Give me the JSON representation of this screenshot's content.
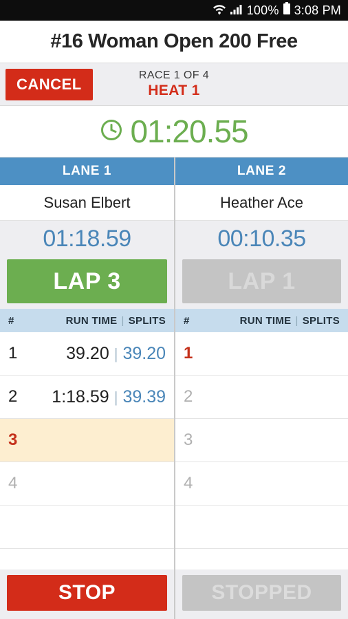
{
  "status_bar": {
    "wifi_icon": "wifi-icon",
    "signal_icon": "signal-bars-icon",
    "battery_percent": "100%",
    "battery_icon": "battery-full-icon",
    "time": "3:08 PM"
  },
  "header": {
    "title": "#16 Woman Open 200 Free"
  },
  "race_bar": {
    "cancel_label": "CANCEL",
    "race_line": "RACE 1 OF 4",
    "heat_line": "HEAT 1",
    "heat_color": "#d32c19"
  },
  "master_timer": {
    "clock_icon": "clock-icon",
    "value": "01:20.55",
    "color": "#6cae50"
  },
  "columns": {
    "num_header": "#",
    "run_time_header": "RUN TIME",
    "separator": "|",
    "splits_header": "SPLITS"
  },
  "lanes": [
    {
      "header": "LANE 1",
      "swimmer": "Susan Elbert",
      "elapsed": "01:18.59",
      "lap_label": "LAP 3",
      "lap_state": "active",
      "action_label": "STOP",
      "action_state": "active",
      "rows": [
        {
          "num": "1",
          "num_state": "done",
          "run": "39.20",
          "split": "39.20",
          "highlight": false
        },
        {
          "num": "2",
          "num_state": "done",
          "run": "1:18.59",
          "split": "39.39",
          "highlight": false
        },
        {
          "num": "3",
          "num_state": "active",
          "run": "",
          "split": "",
          "highlight": true
        },
        {
          "num": "4",
          "num_state": "pending",
          "run": "",
          "split": "",
          "highlight": false
        },
        {
          "num": "",
          "num_state": "pending",
          "run": "",
          "split": "",
          "highlight": false
        }
      ]
    },
    {
      "header": "LANE 2",
      "swimmer": "Heather Ace",
      "elapsed": "00:10.35",
      "lap_label": "LAP 1",
      "lap_state": "disabled",
      "action_label": "STOPPED",
      "action_state": "disabled",
      "rows": [
        {
          "num": "1",
          "num_state": "active",
          "run": "",
          "split": "",
          "highlight": false
        },
        {
          "num": "2",
          "num_state": "pending",
          "run": "",
          "split": "",
          "highlight": false
        },
        {
          "num": "3",
          "num_state": "pending",
          "run": "",
          "split": "",
          "highlight": false
        },
        {
          "num": "4",
          "num_state": "pending",
          "run": "",
          "split": "",
          "highlight": false
        },
        {
          "num": "",
          "num_state": "pending",
          "run": "",
          "split": "",
          "highlight": false
        }
      ]
    }
  ],
  "colors": {
    "accent_blue": "#4d90c4",
    "accent_green": "#6cae50",
    "accent_red": "#d32c19",
    "highlight_row": "#fdeed0",
    "header_band": "#c6dced"
  }
}
